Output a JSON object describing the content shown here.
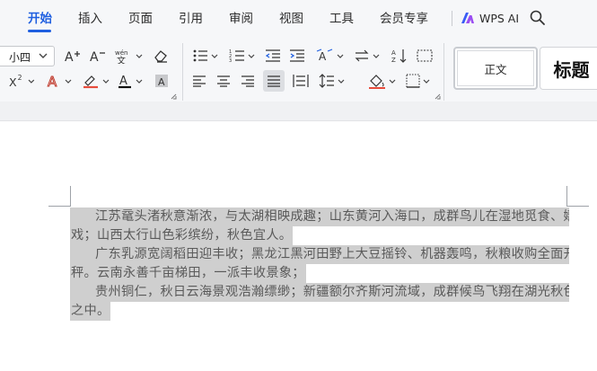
{
  "menu": {
    "tabs": [
      {
        "label": "开始",
        "active": true
      },
      {
        "label": "插入"
      },
      {
        "label": "页面"
      },
      {
        "label": "引用"
      },
      {
        "label": "审阅"
      },
      {
        "label": "视图"
      },
      {
        "label": "工具"
      },
      {
        "label": "会员专享"
      }
    ],
    "wps_ai_label": "WPS AI",
    "search_icon": "search-icon"
  },
  "ribbon": {
    "font_size": "小四",
    "buttons": {
      "grow_font": "A⁺",
      "shrink_font": "A⁻",
      "superscript": "X²",
      "text_effect": "A",
      "font_color": "A",
      "char_shading": "A"
    },
    "styles": {
      "normal": "正文",
      "heading": "标题"
    }
  },
  "colors": {
    "accent": "#1f5fe0",
    "selection": "#cfcfcf",
    "wps_ai_logo": "#3b5cf5"
  },
  "document": {
    "lines": [
      {
        "indent": true,
        "text": "江苏鼋头渚秋意渐浓，与太湖相映成趣；山东黄河入海口，成群鸟儿在湿地觅食、嬉"
      },
      {
        "indent": false,
        "text": "戏；山西太行山色彩缤纷，秋色宜人。"
      },
      {
        "indent": true,
        "text": "广东乳源宽阔稻田迎丰收；黑龙江黑河田野上大豆摇铃、机器轰鸣，秋粮收购全面开"
      },
      {
        "indent": false,
        "text": "秤。云南永善千亩梯田，一派丰收景象；"
      },
      {
        "indent": true,
        "text": "贵州铜仁，秋日云海景观浩瀚缥缈；新疆额尔齐斯河流域，成群候鸟飞翔在湖光秋色"
      },
      {
        "indent": false,
        "text": "之中。"
      }
    ]
  }
}
